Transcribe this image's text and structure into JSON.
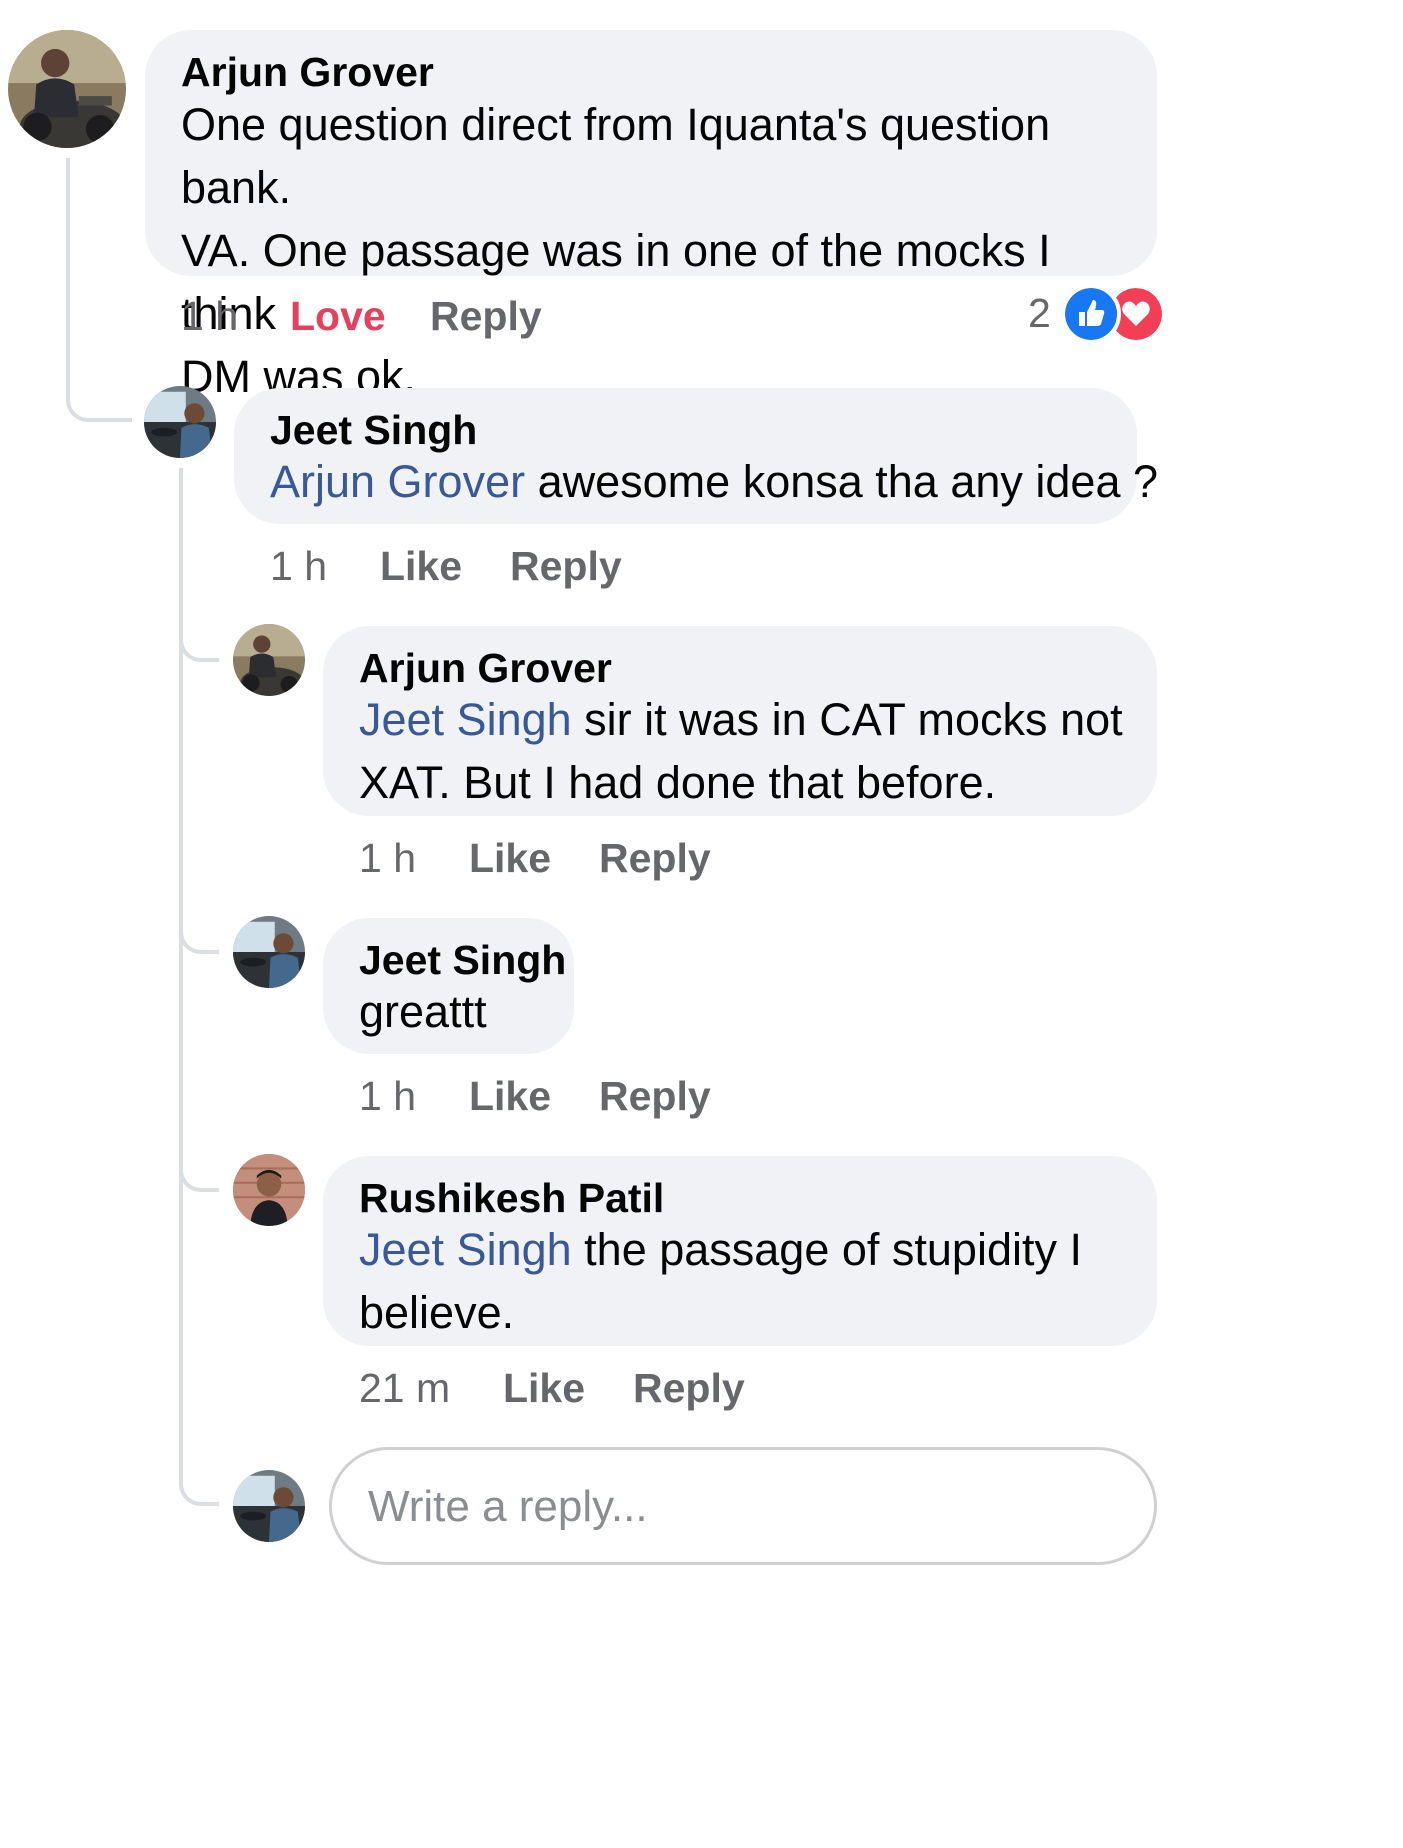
{
  "thread": {
    "root": {
      "author": "Arjun Grover",
      "text_lines": [
        "One question direct from Iquanta's question bank.",
        "VA. One passage was in one of the mocks I think",
        "DM was ok."
      ],
      "time": "1 h",
      "reaction_label": "Love",
      "reply_label": "Reply",
      "reaction_count": "2",
      "reaction_icons": [
        "like-icon",
        "love-icon"
      ]
    },
    "replies": [
      {
        "author": "Jeet Singh",
        "mention": "Arjun Grover",
        "text_lines": [
          " awesome konsa tha any idea ?"
        ],
        "time": "1 h",
        "like_label": "Like",
        "reply_label": "Reply"
      },
      {
        "author": "Arjun Grover",
        "mention": "Jeet Singh",
        "text_lines": [
          " sir it was in CAT mocks not",
          "XAT. But I had done that before."
        ],
        "time": "1 h",
        "like_label": "Like",
        "reply_label": "Reply"
      },
      {
        "author": "Jeet Singh",
        "mention": "",
        "text_lines": [
          "greattt"
        ],
        "time": "1 h",
        "like_label": "Like",
        "reply_label": "Reply"
      },
      {
        "author": "Rushikesh Patil",
        "mention": "Jeet Singh",
        "text_lines": [
          " the passage of stupidity I",
          "believe."
        ],
        "time": "21 m",
        "like_label": "Like",
        "reply_label": "Reply"
      }
    ],
    "reply_box": {
      "placeholder": "Write a reply..."
    }
  },
  "colors": {
    "bubble_bg": "#f0f2f5",
    "mention": "#385898",
    "meta_text": "#65676b",
    "love": "#e4405f",
    "like_blue": "#1877f2",
    "love_red": "#f33e58",
    "thread_line": "#dadde1"
  }
}
